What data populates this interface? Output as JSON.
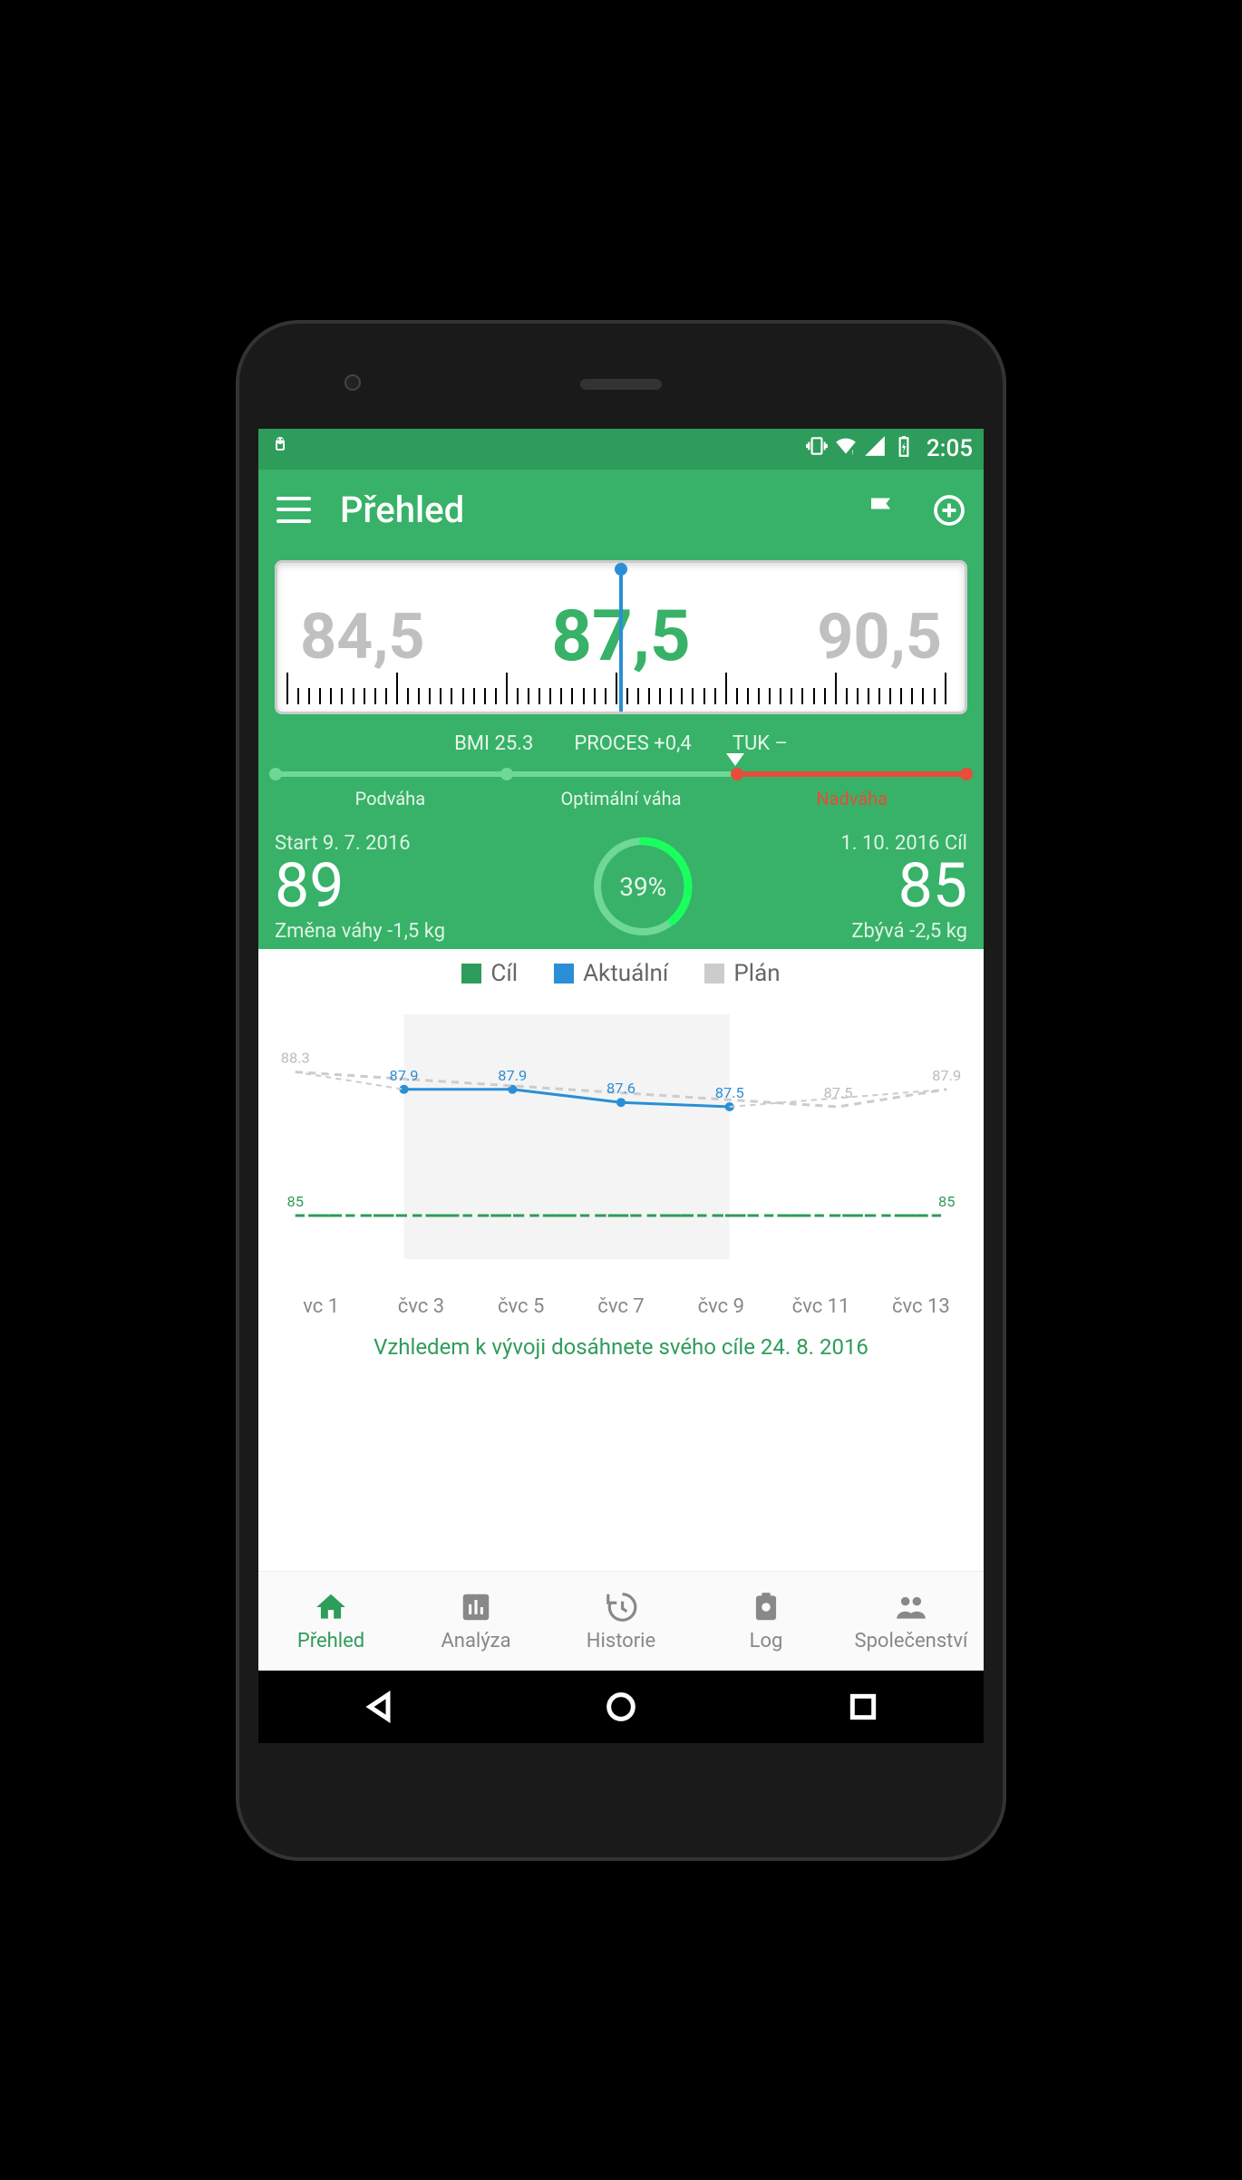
{
  "status": {
    "time": "2:05"
  },
  "appbar": {
    "title": "Přehled"
  },
  "picker": {
    "left": "84,5",
    "center": "87,5",
    "right": "90,5"
  },
  "metrics": {
    "bmi": "BMI 25.3",
    "process": "PROCES +0,4",
    "fat": "TUK –"
  },
  "scale": {
    "under": "Podváha",
    "optimal": "Optimální váha",
    "over": "Nadváha"
  },
  "goal": {
    "start_label": "Start 9. 7. 2016",
    "start_value": "89",
    "start_delta": "Změna váhy -1,5 kg",
    "pct": "39%",
    "end_label": "1. 10. 2016 Cíl",
    "end_value": "85",
    "end_delta": "Zbývá -2,5 kg"
  },
  "legend": {
    "goal": "Cíl",
    "actual": "Aktuální",
    "plan": "Plán"
  },
  "forecast": "Vzhledem k vývoji dosáhnete svého cíle 24. 8. 2016",
  "xaxis": [
    "vc 1",
    "čvc 3",
    "čvc 5",
    "čvc 7",
    "čvc 9",
    "čvc 11",
    "čvc 13"
  ],
  "nav": {
    "overview": "Přehled",
    "analysis": "Analýza",
    "history": "Historie",
    "log": "Log",
    "community": "Společenství"
  },
  "chart_data": {
    "type": "line",
    "title": "",
    "xlabel": "",
    "ylabel": "",
    "ylim": [
      84,
      89
    ],
    "categories": [
      "čvc 1",
      "čvc 3",
      "čvc 5",
      "čvc 7",
      "čvc 9",
      "čvc 11",
      "čvc 13"
    ],
    "series": [
      {
        "name": "Cíl",
        "values": [
          85,
          85,
          85,
          85,
          85,
          85,
          85
        ],
        "color": "#2e9c5a",
        "style": "dashed"
      },
      {
        "name": "Aktuální",
        "values": [
          null,
          87.9,
          87.9,
          87.6,
          87.5,
          null,
          null
        ],
        "color": "#2a8fd6",
        "style": "solid"
      },
      {
        "name": "Plán",
        "values": [
          88.3,
          null,
          null,
          null,
          null,
          87.5,
          87.9
        ],
        "color": "#cccccc",
        "style": "dashed"
      }
    ],
    "point_labels": [
      {
        "x": "čvc 1",
        "y": 88.3,
        "text": "88.3"
      },
      {
        "x": "čvc 1",
        "y": 85,
        "text": "85"
      },
      {
        "x": "čvc 3",
        "y": 87.9,
        "text": "87.9"
      },
      {
        "x": "čvc 5",
        "y": 87.9,
        "text": "87.9"
      },
      {
        "x": "čvc 7",
        "y": 87.6,
        "text": "87.6"
      },
      {
        "x": "čvc 9",
        "y": 87.5,
        "text": "87.5"
      },
      {
        "x": "čvc 11",
        "y": 87.5,
        "text": "87.5"
      },
      {
        "x": "čvc 13",
        "y": 87.9,
        "text": "87.9"
      },
      {
        "x": "čvc 13",
        "y": 85,
        "text": "85"
      }
    ]
  }
}
